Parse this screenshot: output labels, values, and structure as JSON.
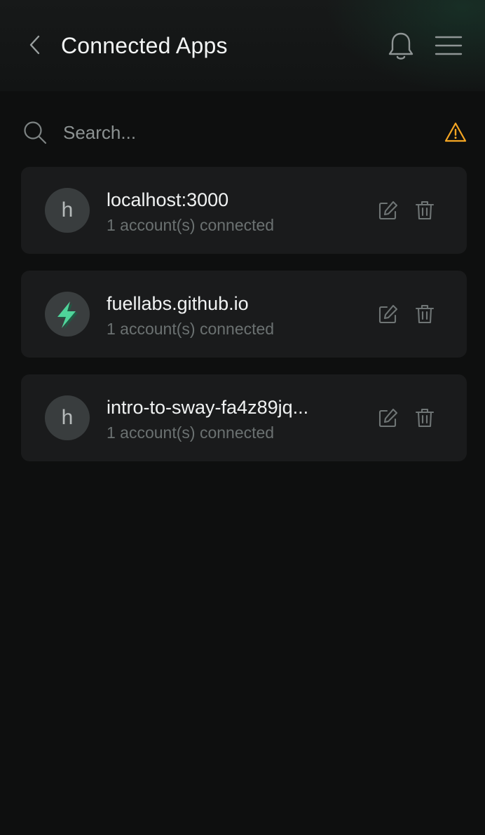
{
  "header": {
    "title": "Connected Apps",
    "back_icon": "chevron-left-icon",
    "bell_icon": "bell-icon",
    "menu_icon": "hamburger-menu-icon"
  },
  "search": {
    "placeholder": "Search...",
    "value": "",
    "icon": "search-icon",
    "warning_icon": "warning-triangle-icon",
    "warning_color": "#f5a623"
  },
  "apps": [
    {
      "avatar_letter": "h",
      "avatar_type": "letter",
      "name": "localhost:3000",
      "subtitle": "1 account(s) connected"
    },
    {
      "avatar_letter": "",
      "avatar_type": "fuel-logo",
      "name": "fuellabs.github.io",
      "subtitle": "1 account(s) connected"
    },
    {
      "avatar_letter": "h",
      "avatar_type": "letter",
      "name": "intro-to-sway-fa4z89jq...",
      "subtitle": "1 account(s) connected"
    }
  ],
  "colors": {
    "background": "#0e0f0f",
    "card": "#1a1b1c",
    "accent_green": "#4fd49a",
    "warning": "#f5a623"
  }
}
